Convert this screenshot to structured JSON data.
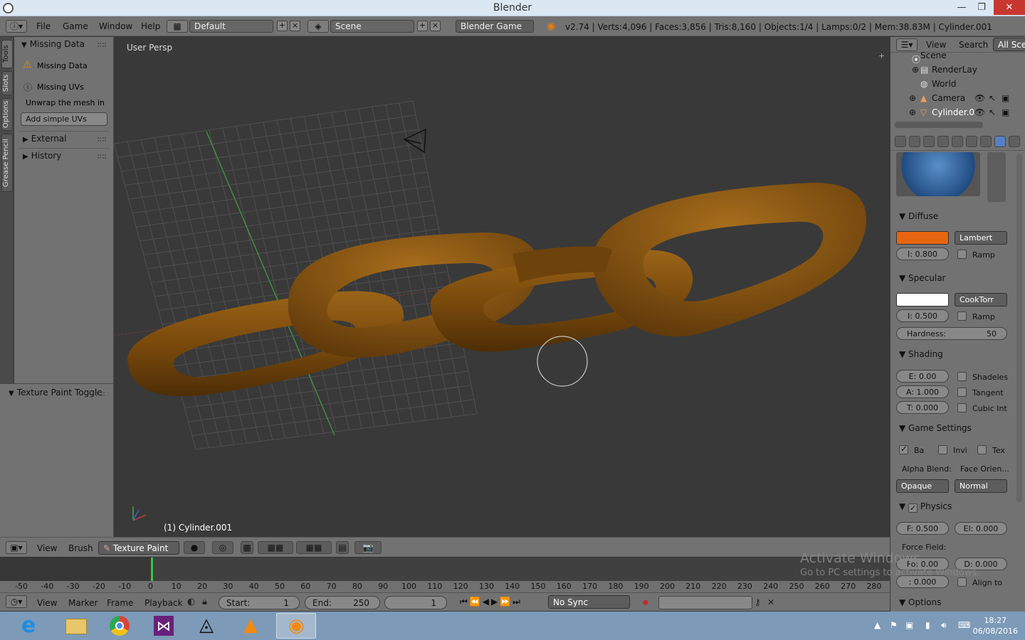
{
  "window": {
    "title": "Blender"
  },
  "menu": {
    "file": "File",
    "game": "Game",
    "window": "Window",
    "help": "Help"
  },
  "layout": {
    "name": "Default"
  },
  "scene": {
    "name": "Scene"
  },
  "engine": {
    "name": "Blender Game"
  },
  "stats": "v2.74 | Verts:4,096 | Faces:3,856 | Tris:8,160 | Objects:1/4 | Lamps:0/2 | Mem:38.83M | Cylinder.001",
  "left_tabs": [
    "Tools",
    "Slots",
    "Options",
    "Grease Pencil"
  ],
  "toolshelf": {
    "missing_data_header": "Missing Data",
    "missing_data": "Missing Data",
    "missing_uvs": "Missing UVs",
    "unwrap_hint": "Unwrap the mesh in ...",
    "add_simple_uvs": "Add simple UVs",
    "external": "External",
    "history": "History",
    "texture_paint_toggle": "Texture Paint Toggle"
  },
  "viewport": {
    "label": "User Persp",
    "object_label": "(1) Cylinder.001"
  },
  "view3d_header": {
    "view": "View",
    "brush": "Brush",
    "mode": "Texture Paint"
  },
  "timeline": {
    "ticks": [
      "-50",
      "-40",
      "-30",
      "-20",
      "-10",
      "0",
      "10",
      "20",
      "30",
      "40",
      "50",
      "60",
      "70",
      "80",
      "90",
      "100",
      "110",
      "120",
      "130",
      "140",
      "150",
      "160",
      "170",
      "180",
      "190",
      "200",
      "210",
      "220",
      "230",
      "240",
      "250",
      "260",
      "270",
      "280"
    ],
    "current_frame": "1",
    "start_label": "Start:",
    "start": "1",
    "end_label": "End:",
    "end": "250",
    "sync": "No Sync"
  },
  "timeline_header": {
    "view": "View",
    "marker": "Marker",
    "frame": "Frame",
    "playback": "Playback"
  },
  "outliner": {
    "view": "View",
    "search": "Search",
    "filter": "All Scen",
    "items": [
      "Scene",
      "RenderLay",
      "World",
      "Camera",
      "Cylinder.0"
    ]
  },
  "material": {
    "diffuse": {
      "header": "Diffuse",
      "color": "#e8650f",
      "shader": "Lambert",
      "intensity": "I:  0.800",
      "ramp": "Ramp"
    },
    "specular": {
      "header": "Specular",
      "color": "#ffffff",
      "shader": "CookTorr",
      "intensity": "I:  0.500",
      "ramp": "Ramp",
      "hardness_label": "Hardness:",
      "hardness": "50"
    },
    "shading": {
      "header": "Shading",
      "emit": "E:  0.00",
      "ambient": "A: 1.000",
      "translucency": "T:  0.000",
      "shadeless": "Shadeles",
      "tangent": "Tangent",
      "cubic": "Cubic Int"
    },
    "game_settings": {
      "header": "Game Settings",
      "backface": "Ba",
      "invisible": "Invi",
      "text": "Tex",
      "alpha_blend": "Alpha Blend:",
      "face_orient": "Face Orien...",
      "alpha_value": "Opaque",
      "orient_value": "Normal"
    },
    "physics": {
      "header": "Physics",
      "friction": "F: 0.500",
      "elasticity": "El: 0.000",
      "force_field": "Force Field:",
      "force": "Fo: 0.00",
      "damping": "D:  0.000",
      "distance": ":  0.000",
      "align": "Align to"
    },
    "options": {
      "header": "Options"
    }
  },
  "watermark": {
    "title": "Activate Windows",
    "subtitle": "Go to PC settings to activate Windows."
  },
  "taskbar": {
    "time": "18:27",
    "date": "06/08/2016"
  },
  "colors": {
    "chain": "#7a4a0c",
    "accent_active": "#5680c2",
    "diffuse": "#e8650f"
  }
}
